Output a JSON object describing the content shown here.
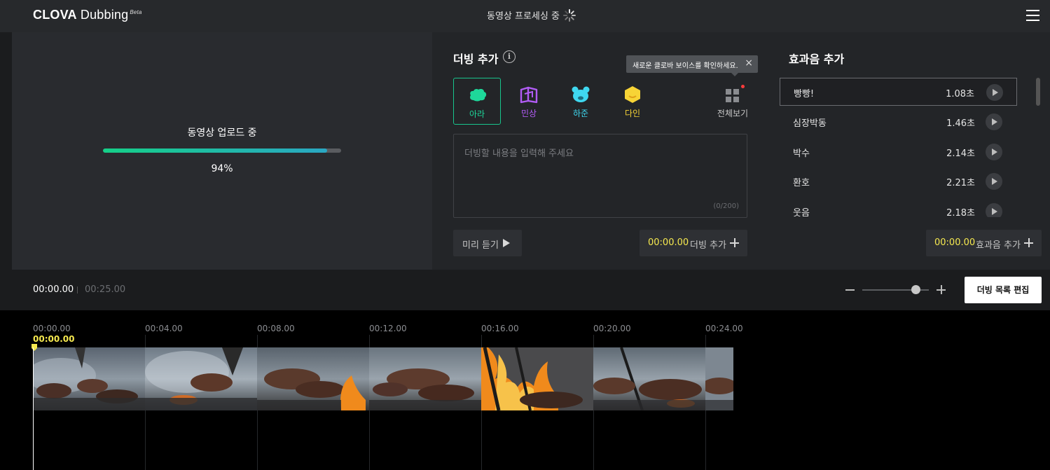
{
  "header": {
    "logo_main": "CLOVA",
    "logo_sub": "Dubbing",
    "logo_beta": "Beta",
    "status": "동영상 프로세싱 중"
  },
  "upload": {
    "title": "동영상 업로드 중",
    "progress": 0.94,
    "percent": "94%"
  },
  "dubbing": {
    "title": "더빙 추가",
    "tooltip": "새로운 클로바 보이스를 확인하세요.",
    "voices": [
      {
        "name": "아라",
        "color": "#1ed89a",
        "icon": "cloud-icon",
        "selected": true
      },
      {
        "name": "민상",
        "color": "#b15cf5",
        "icon": "book-icon",
        "selected": false
      },
      {
        "name": "하준",
        "color": "#3fd8f0",
        "icon": "bear-icon",
        "selected": false
      },
      {
        "name": "다인",
        "color": "#f7d436",
        "icon": "hexagon-icon",
        "selected": false
      }
    ],
    "all_voices_label": "전체보기",
    "input_placeholder": "더빙할 내용을 입력해 주세요",
    "char_count": "(0/200)",
    "preview_label": "미리 듣기",
    "add_time": "00:00.00",
    "add_label": "더빙 추가"
  },
  "sfx": {
    "title": "효과음 추가",
    "items": [
      {
        "name": "빵빵!",
        "duration": "1.08초",
        "active": true
      },
      {
        "name": "심장박동",
        "duration": "1.46초",
        "active": false
      },
      {
        "name": "박수",
        "duration": "2.14초",
        "active": false
      },
      {
        "name": "환호",
        "duration": "2.21초",
        "active": false
      },
      {
        "name": "웃음",
        "duration": "2.18초",
        "active": false
      }
    ],
    "add_time": "00:00.00",
    "add_label": "효과음 추가"
  },
  "timeline": {
    "current_time": "00:00.00",
    "total_time": "00:25.00",
    "zoom_level": 0.8,
    "edit_list_label": "더빙 목록 편집",
    "ticks": [
      "00:00.00",
      "00:04.00",
      "00:08.00",
      "00:12.00",
      "00:16.00",
      "00:20.00",
      "00:24.00"
    ],
    "playhead_time": "00:00.00"
  },
  "colors": {
    "accent_green": "#18c58d",
    "time_yellow": "#f6e94f"
  }
}
